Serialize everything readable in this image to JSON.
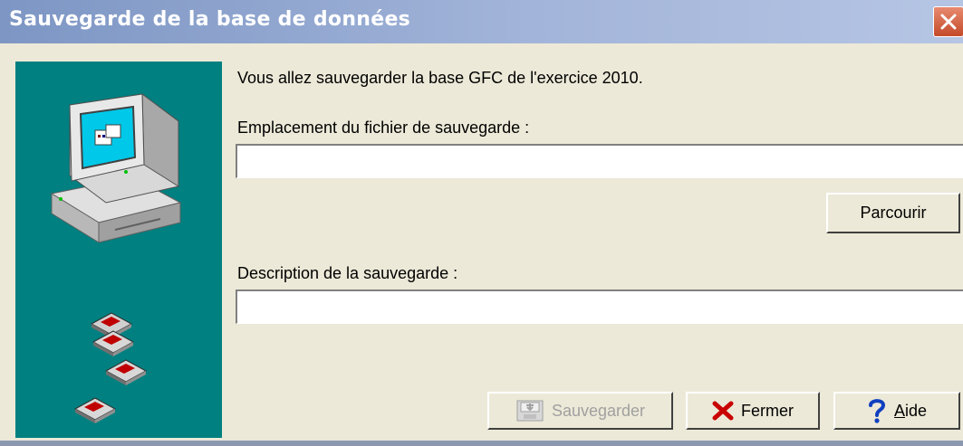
{
  "window": {
    "title": "Sauvegarde de la base de données"
  },
  "main": {
    "intro": "Vous allez sauvegarder la base GFC de l'exercice 2010.",
    "location_label": "Emplacement du fichier de sauvegarde :",
    "location_value": "",
    "browse_label": "Parcourir",
    "description_label": "Description de la sauvegarde :",
    "description_value": ""
  },
  "buttons": {
    "save_label": "Sauvegarder",
    "close_label": "Fermer",
    "help_label": "Aide"
  },
  "icons": {
    "window_close": "close-icon",
    "computer": "computer-icon",
    "disks": "floppy-disk-icon",
    "save": "save-icon",
    "close": "red-x-icon",
    "help": "question-mark-icon"
  },
  "colors": {
    "sidebar": "#008080",
    "window_bg": "#ece9d8",
    "title_bar": "#7d96c4",
    "close_button": "#d05a3a"
  }
}
